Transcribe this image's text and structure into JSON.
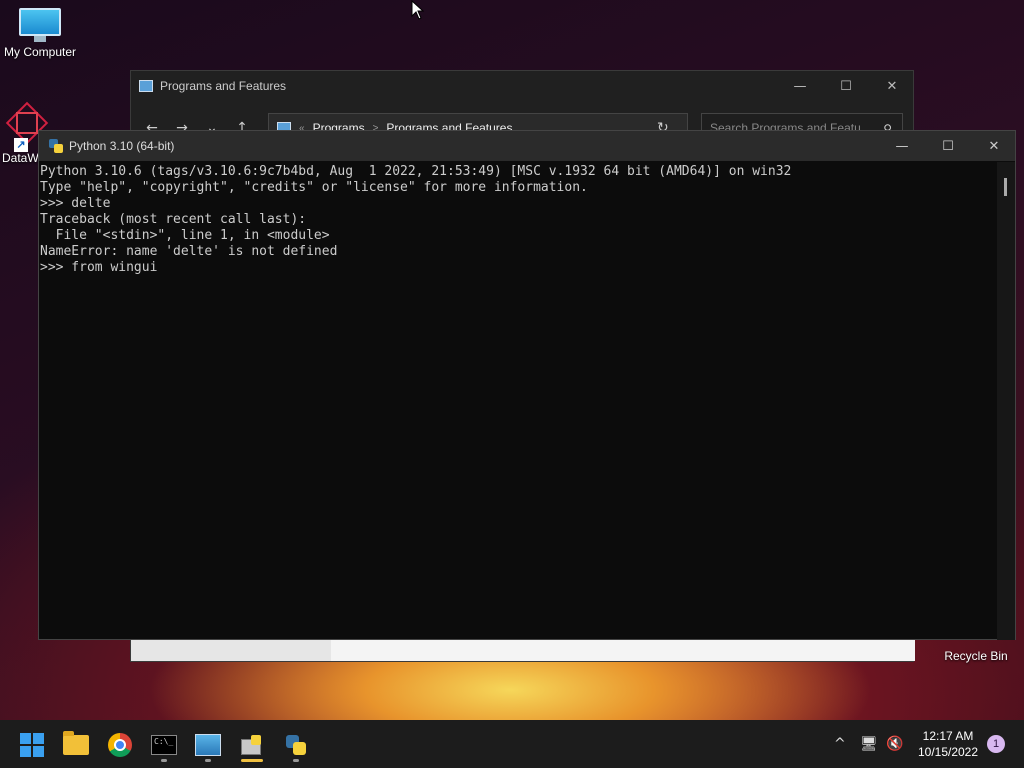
{
  "desktop": {
    "icons": [
      {
        "label": "My Computer"
      },
      {
        "label": "DataW"
      },
      {
        "label": "Recycle Bin"
      }
    ]
  },
  "programs_window": {
    "title": "Programs and Features",
    "address": {
      "crumb1": "Programs",
      "crumb2": "Programs and Features",
      "sep": ">",
      "overflow": "«"
    },
    "search_placeholder": "Search Programs and Featu",
    "controls": {
      "minimize": "—",
      "maximize": "☐",
      "close": "✕"
    }
  },
  "python_window": {
    "title": "Python 3.10 (64-bit)",
    "controls": {
      "minimize": "—",
      "maximize": "☐",
      "close": "✕"
    },
    "console_lines": [
      "Python 3.10.6 (tags/v3.10.6:9c7b4bd, Aug  1 2022, 21:53:49) [MSC v.1932 64 bit (AMD64)] on win32",
      "Type \"help\", \"copyright\", \"credits\" or \"license\" for more information.",
      ">>> delte",
      "Traceback (most recent call last):",
      "  File \"<stdin>\", line 1, in <module>",
      "NameError: name 'delte' is not defined",
      ">>> from wingui"
    ]
  },
  "taskbar": {
    "clock_time": "12:17 AM",
    "clock_date": "10/15/2022",
    "notification_count": "1",
    "tray": {
      "chevron": "^",
      "network": "🖥",
      "volume": "🔇"
    }
  },
  "colors": {
    "console_bg": "#0c0c0c",
    "console_text": "#cccccc",
    "taskbar_bg": "#1c1c1c",
    "active_indicator": "#f0c040"
  }
}
